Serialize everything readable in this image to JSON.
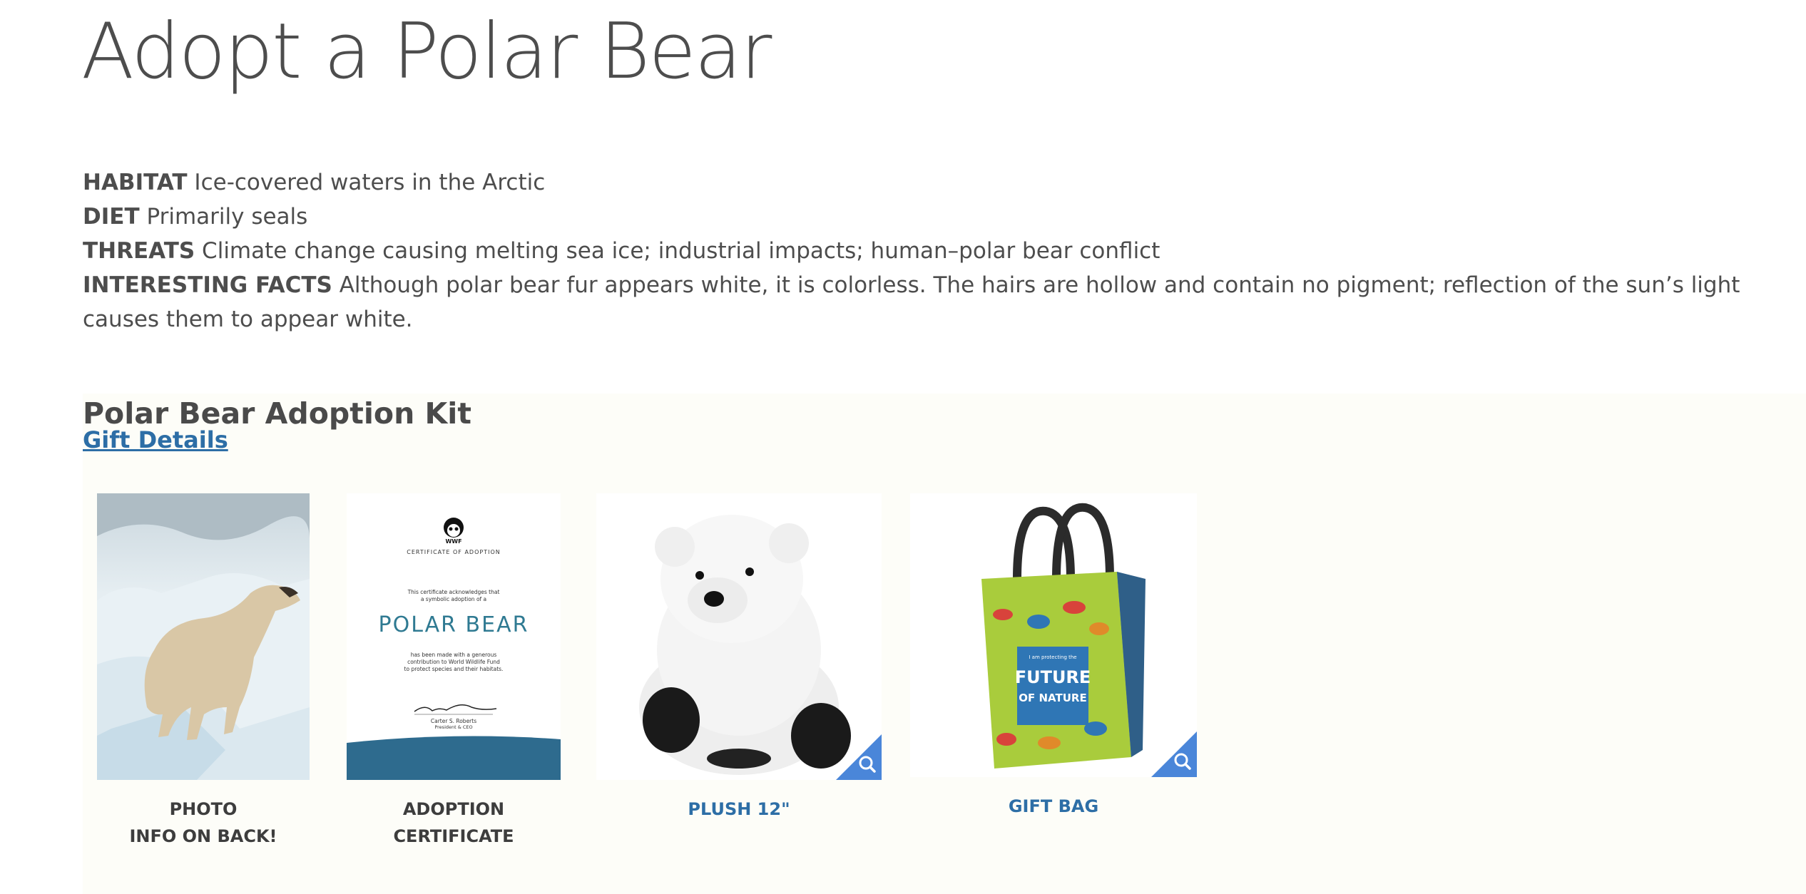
{
  "page": {
    "title": "Adopt a Polar Bear"
  },
  "facts": [
    {
      "label": "HABITAT",
      "text": " Ice-covered waters in the Arctic"
    },
    {
      "label": "DIET",
      "text": " Primarily seals"
    },
    {
      "label": "THREATS",
      "text": " Climate change causing melting sea ice; industrial impacts; human–polar bear conflict"
    },
    {
      "label": "INTERESTING FACTS",
      "text": " Although polar bear fur appears white, it is colorless. The hairs are hollow and contain no pigment; reflection of the sun’s light causes them to appear white."
    }
  ],
  "kit": {
    "title": "Polar Bear Adoption Kit",
    "gift_details_label": "Gift Details",
    "items": [
      {
        "caption_line1": "PHOTO",
        "caption_line2": "INFO ON BACK!"
      },
      {
        "caption_line1": "ADOPTION CERTIFICATE"
      },
      {
        "caption_line1": "PLUSH 12\""
      },
      {
        "caption_line1": "GIFT BAG"
      }
    ],
    "certificate": {
      "logo_text": "WWF",
      "heading": "CERTIFICATE OF ADOPTION",
      "intro": "This certificate acknowledges that",
      "intro2": "a symbolic adoption of a",
      "animal": "POLAR BEAR",
      "body1": "has been made with a generous",
      "body2": "contribution to World Wildlife Fund",
      "body3": "to protect species and their habitats.",
      "signer": "Carter S. Roberts",
      "signer_title": "President & CEO"
    },
    "gift_bag_text": {
      "small": "I am protecting the",
      "big1": "FUTURE",
      "big2": "OF NATURE"
    }
  },
  "colors": {
    "link": "#2d6ea6",
    "zoom_badge": "#4a86d9",
    "kit_bg": "#fdfdf8"
  },
  "icons": {
    "zoom": "magnifier-icon"
  }
}
